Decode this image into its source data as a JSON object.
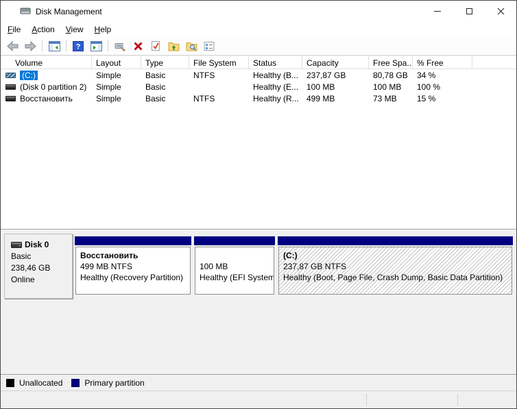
{
  "window": {
    "title": "Disk Management",
    "controls": [
      "minimize",
      "maximize",
      "close"
    ]
  },
  "menu": {
    "items": [
      {
        "label": "File"
      },
      {
        "label": "Action"
      },
      {
        "label": "View"
      },
      {
        "label": "Help"
      }
    ]
  },
  "toolbar": {
    "buttons": [
      "back",
      "forward",
      "show-console-tree",
      "help",
      "show-action-pane",
      "device-properties",
      "delete-volume",
      "check-document",
      "folder-up",
      "folder-search",
      "properties-list"
    ]
  },
  "volume_table": {
    "columns": [
      "Volume",
      "Layout",
      "Type",
      "File System",
      "Status",
      "Capacity",
      "Free Spa...",
      "% Free",
      ""
    ],
    "rows": [
      {
        "volume": "(C:)",
        "layout": "Simple",
        "type": "Basic",
        "file_system": "NTFS",
        "status": "Healthy (B...",
        "capacity": "237,87 GB",
        "free_space": "80,78 GB",
        "pct_free": "34 %",
        "selected": true
      },
      {
        "volume": "(Disk 0 partition 2)",
        "layout": "Simple",
        "type": "Basic",
        "file_system": "",
        "status": "Healthy (E...",
        "capacity": "100 MB",
        "free_space": "100 MB",
        "pct_free": "100 %",
        "selected": false
      },
      {
        "volume": "Восстановить",
        "layout": "Simple",
        "type": "Basic",
        "file_system": "NTFS",
        "status": "Healthy (R...",
        "capacity": "499 MB",
        "free_space": "73 MB",
        "pct_free": "15 %",
        "selected": false
      }
    ]
  },
  "disk_view": {
    "disk": {
      "name": "Disk 0",
      "type": "Basic",
      "size": "238,46 GB",
      "status": "Online"
    },
    "partitions": [
      {
        "label": "Восстановить",
        "size_line": "499 MB NTFS",
        "status_line": "Healthy (Recovery Partition)",
        "selected": false
      },
      {
        "label": "",
        "size_line": "100 MB",
        "status_line": "Healthy (EFI System Partition)",
        "selected": false
      },
      {
        "label": "(C:)",
        "size_line": "237,87 GB NTFS",
        "status_line": "Healthy (Boot, Page File, Crash Dump, Basic Data Partition)",
        "selected": true
      }
    ]
  },
  "legend": {
    "items": [
      {
        "label": "Unallocated",
        "color": "#000000"
      },
      {
        "label": "Primary partition",
        "color": "#000080"
      }
    ]
  },
  "status_bar": {
    "text": ""
  },
  "colors": {
    "selection": "#0078d7",
    "partition_bar": "#000080",
    "pane_background": "#f1f1f1",
    "window_border": "#4a4a4a"
  }
}
